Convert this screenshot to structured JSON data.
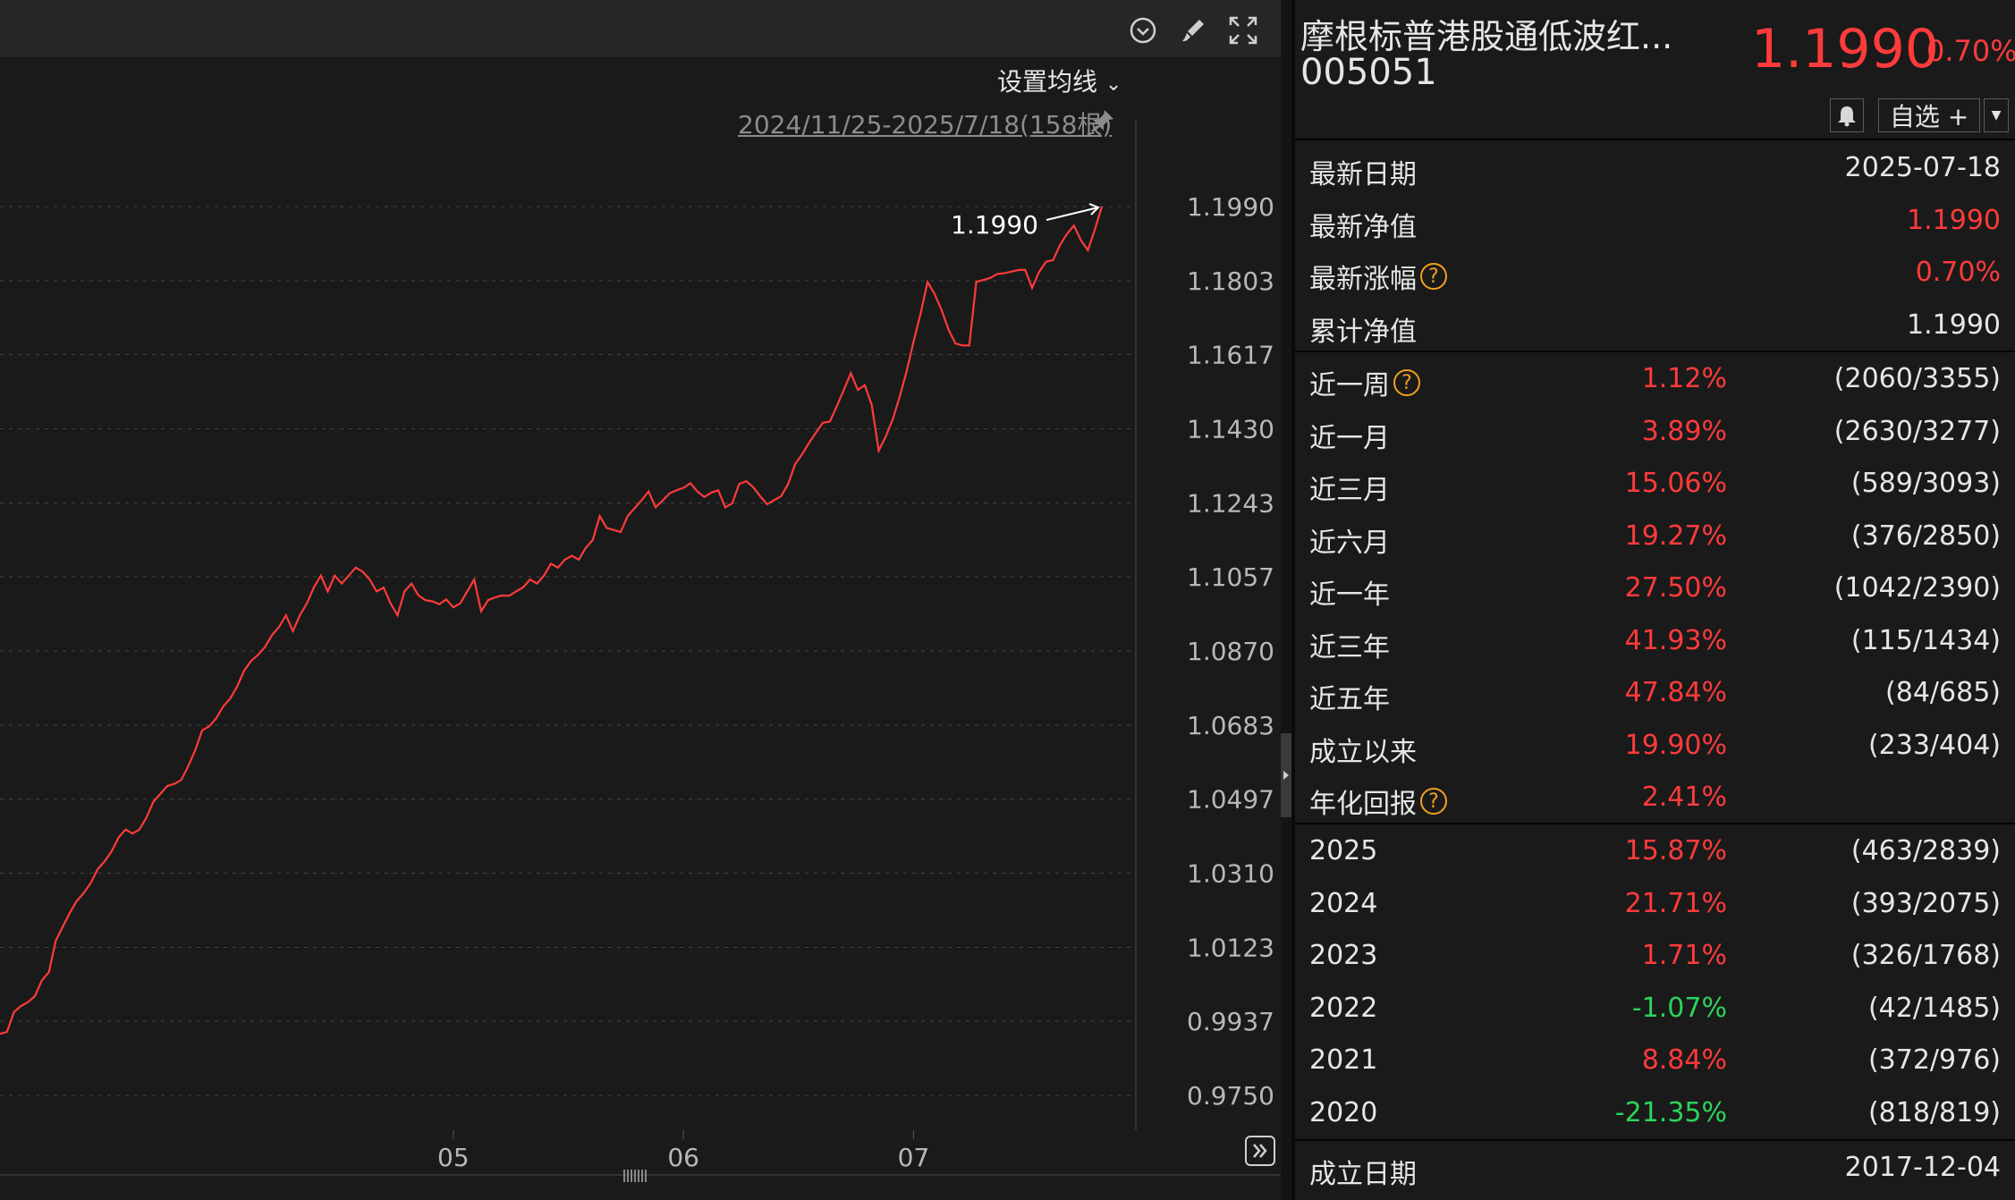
{
  "toolbar": {
    "icons": [
      "circle-chevron-down-icon",
      "brush-icon",
      "fullscreen-icon"
    ]
  },
  "chart_header": {
    "ma_setting_label": "设置均线",
    "range_label": "2024/11/25-2025/7/18(158根)"
  },
  "chart_data": {
    "type": "line",
    "series": [
      {
        "values": [
          0.9905,
          0.991,
          0.996,
          0.9975,
          0.9985,
          1.0,
          1.004,
          1.006,
          1.014,
          1.0175,
          1.021,
          1.024,
          1.026,
          1.0285,
          1.032,
          1.034,
          1.0365,
          1.04,
          1.042,
          1.041,
          1.042,
          1.045,
          1.049,
          1.051,
          1.053,
          1.0535,
          1.0545,
          1.058,
          1.062,
          1.067,
          1.068,
          1.07,
          1.073,
          1.075,
          1.078,
          1.082,
          1.0845,
          1.086,
          1.088,
          1.091,
          1.093,
          1.096,
          1.092,
          1.096,
          1.099,
          1.103,
          1.106,
          1.102,
          1.106,
          1.104,
          1.106,
          1.108,
          1.107,
          1.105,
          1.102,
          1.103,
          1.099,
          1.096,
          1.102,
          1.104,
          1.101,
          1.0998,
          1.0995,
          1.0988,
          1.1,
          1.098,
          1.099,
          1.102,
          1.105,
          1.097,
          1.0998,
          1.1005,
          1.101,
          1.1009,
          1.102,
          1.103,
          1.105,
          1.104,
          1.106,
          1.109,
          1.108,
          1.11,
          1.111,
          1.11,
          1.113,
          1.115,
          1.121,
          1.118,
          1.1175,
          1.117,
          1.121,
          1.123,
          1.125,
          1.1272,
          1.1232,
          1.1249,
          1.1267,
          1.1275,
          1.1281,
          1.1293,
          1.1272,
          1.1258,
          1.1269,
          1.1275,
          1.1232,
          1.1242,
          1.1291,
          1.1298,
          1.1283,
          1.126,
          1.124,
          1.125,
          1.126,
          1.129,
          1.134,
          1.1365,
          1.1394,
          1.142,
          1.1445,
          1.1448,
          1.1487,
          1.1528,
          1.157,
          1.1528,
          1.154,
          1.149,
          1.1375,
          1.141,
          1.1453,
          1.151,
          1.1575,
          1.165,
          1.172,
          1.18,
          1.177,
          1.173,
          1.168,
          1.1645,
          1.164,
          1.164,
          1.18,
          1.1805,
          1.181,
          1.182,
          1.1822,
          1.1826,
          1.183,
          1.1831,
          1.1785,
          1.1825,
          1.1851,
          1.1855,
          1.1893,
          1.1921,
          1.1942,
          1.1905,
          1.188,
          1.1932,
          1.199
        ]
      }
    ],
    "x_tick_labels": [
      "05",
      "06",
      "07"
    ],
    "y_tick_labels": [
      "1.1990",
      "1.1803",
      "1.1617",
      "1.1430",
      "1.1243",
      "1.1057",
      "1.0870",
      "1.0683",
      "1.0497",
      "1.0310",
      "1.0123",
      "0.9937",
      "0.9750"
    ],
    "ylim": [
      0.975,
      1.199
    ],
    "last_value_label": "1.1990",
    "grid": true
  },
  "fund": {
    "name": "摩根标普港股通低波红...",
    "code": "005051",
    "price": "1.1990",
    "change_pct": "0.70%",
    "watch_label": "自选 +"
  },
  "summary": [
    {
      "label": "最新日期",
      "value": "2025-07-18",
      "color": "#e6e6e6",
      "help": false
    },
    {
      "label": "最新净值",
      "value": "1.1990",
      "color": "#ff3b3b",
      "help": false
    },
    {
      "label": "最新涨幅",
      "value": "0.70%",
      "color": "#ff3b3b",
      "help": true
    },
    {
      "label": "累计净值",
      "value": "1.1990",
      "color": "#e6e6e6",
      "help": false
    }
  ],
  "periods": [
    {
      "label": "近一周",
      "pct": "1.12%",
      "rank": "(2060/3355)",
      "color": "#ff3b3b",
      "help": true
    },
    {
      "label": "近一月",
      "pct": "3.89%",
      "rank": "(2630/3277)",
      "color": "#ff3b3b",
      "help": false
    },
    {
      "label": "近三月",
      "pct": "15.06%",
      "rank": "(589/3093)",
      "color": "#ff3b3b",
      "help": false
    },
    {
      "label": "近六月",
      "pct": "19.27%",
      "rank": "(376/2850)",
      "color": "#ff3b3b",
      "help": false
    },
    {
      "label": "近一年",
      "pct": "27.50%",
      "rank": "(1042/2390)",
      "color": "#ff3b3b",
      "help": false
    },
    {
      "label": "近三年",
      "pct": "41.93%",
      "rank": "(115/1434)",
      "color": "#ff3b3b",
      "help": false
    },
    {
      "label": "近五年",
      "pct": "47.84%",
      "rank": "(84/685)",
      "color": "#ff3b3b",
      "help": false
    },
    {
      "label": "成立以来",
      "pct": "19.90%",
      "rank": "(233/404)",
      "color": "#ff3b3b",
      "help": false
    },
    {
      "label": "年化回报",
      "pct": "2.41%",
      "rank": "",
      "color": "#ff3b3b",
      "help": true
    }
  ],
  "years": [
    {
      "label": "2025",
      "pct": "15.87%",
      "rank": "(463/2839)",
      "color": "#ff3b3b"
    },
    {
      "label": "2024",
      "pct": "21.71%",
      "rank": "(393/2075)",
      "color": "#ff3b3b"
    },
    {
      "label": "2023",
      "pct": "1.71%",
      "rank": "(326/1768)",
      "color": "#ff3b3b"
    },
    {
      "label": "2022",
      "pct": "-1.07%",
      "rank": "(42/1485)",
      "color": "#2bd45a"
    },
    {
      "label": "2021",
      "pct": "8.84%",
      "rank": "(372/976)",
      "color": "#ff3b3b"
    },
    {
      "label": "2020",
      "pct": "-21.35%",
      "rank": "(818/819)",
      "color": "#2bd45a"
    }
  ],
  "inception": {
    "label": "成立日期",
    "value": "2017-12-04"
  }
}
